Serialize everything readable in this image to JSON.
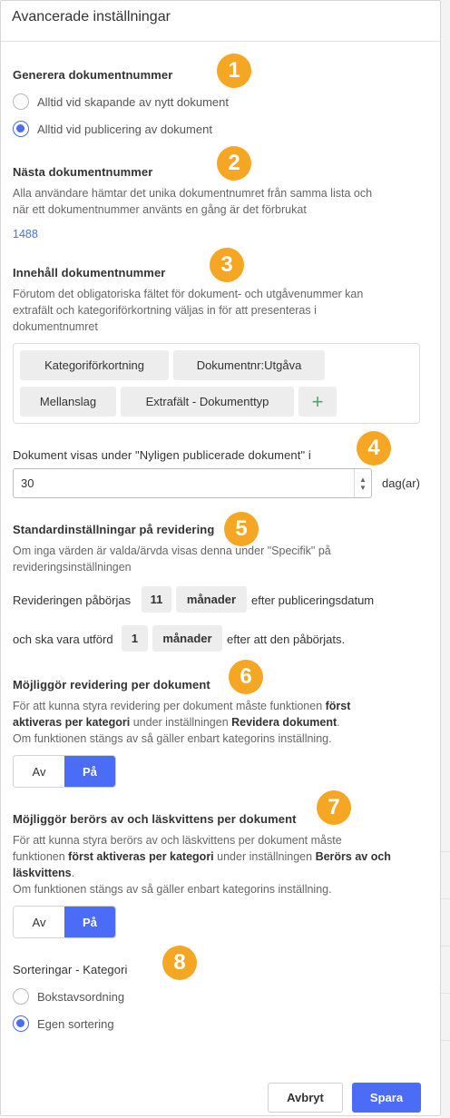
{
  "dialog": {
    "title": "Avancerade inställningar"
  },
  "badges": [
    "1",
    "2",
    "3",
    "4",
    "5",
    "6",
    "7",
    "8"
  ],
  "generate": {
    "title": "Generera dokumentnummer",
    "options": [
      {
        "label": "Alltid vid skapande av nytt dokument",
        "checked": false
      },
      {
        "label": "Alltid vid publicering av dokument",
        "checked": true
      }
    ]
  },
  "next_number": {
    "title": "Nästa dokumentnummer",
    "desc_line1": "Alla användare hämtar det unika dokumentnumret från samma lista och",
    "desc_line2": "när ett dokumentnummer använts en gång är det förbrukat",
    "value": "1488"
  },
  "content": {
    "title": "Innehåll dokumentnummer",
    "desc_line1": "Förutom det obligatoriska fältet för dokument- och utgåvenummer kan",
    "desc_line2": "extrafält och kategoriförkortning väljas in för att presenteras i",
    "desc_line3": "dokumentnumret",
    "tags": [
      "Kategoriförkortning",
      "Dokumentnr:Utgåva",
      "Mellanslag",
      "Extrafält - Dokumenttyp"
    ],
    "add_symbol": "+"
  },
  "recent": {
    "title": "Dokument visas under \"Nyligen publicerade dokument\" i",
    "value": "30",
    "unit": "dag(ar)"
  },
  "revision_defaults": {
    "title": "Standardinställningar på revidering",
    "desc_line1": "Om inga värden är valda/ärvda visas denna under \"Specifik\" på",
    "desc_line2": "revideringsinställningen",
    "row1_prefix": "Revideringen påbörjas",
    "row1_number": "11",
    "row1_unit": "månader",
    "row1_suffix": "efter publiceringsdatum",
    "row2_prefix": "och ska vara utförd",
    "row2_number": "1",
    "row2_unit": "månader",
    "row2_suffix": "efter att den påbörjats."
  },
  "revision_per_doc": {
    "title": "Möjliggör revidering per dokument",
    "desc_a": "För att kunna styra revidering per dokument måste funktionen ",
    "desc_b": "först",
    "desc_c": "aktiveras per kategori",
    "desc_d": " under inställningen ",
    "desc_e": "Revidera dokument",
    "desc_f": ".",
    "desc_line3": "Om funktionen stängs av så gäller enbart kategorins inställning.",
    "off_label": "Av",
    "on_label": "På",
    "selected": "on"
  },
  "read_receipt": {
    "title": "Möjliggör berörs av och läskvittens per dokument",
    "desc_line1": "För att kunna styra berörs av och läskvittens per dokument måste",
    "desc_a": "funktionen ",
    "desc_b": "först aktiveras per kategori",
    "desc_c": " under inställningen ",
    "desc_d": "Berörs av och",
    "desc_e": "läskvittens",
    "desc_f": ".",
    "desc_line4": "Om funktionen stängs av så gäller enbart kategorins inställning.",
    "off_label": "Av",
    "on_label": "På",
    "selected": "on"
  },
  "sorting": {
    "title": "Sorteringar - Kategori",
    "options": [
      {
        "label": "Bokstavsordning",
        "checked": false
      },
      {
        "label": "Egen sortering",
        "checked": true
      }
    ]
  },
  "footer": {
    "cancel_label": "Avbryt",
    "save_label": "Spara"
  },
  "colors": {
    "accent": "#4a6cf7",
    "badge": "#f5a623",
    "plus": "#5aa06a"
  }
}
